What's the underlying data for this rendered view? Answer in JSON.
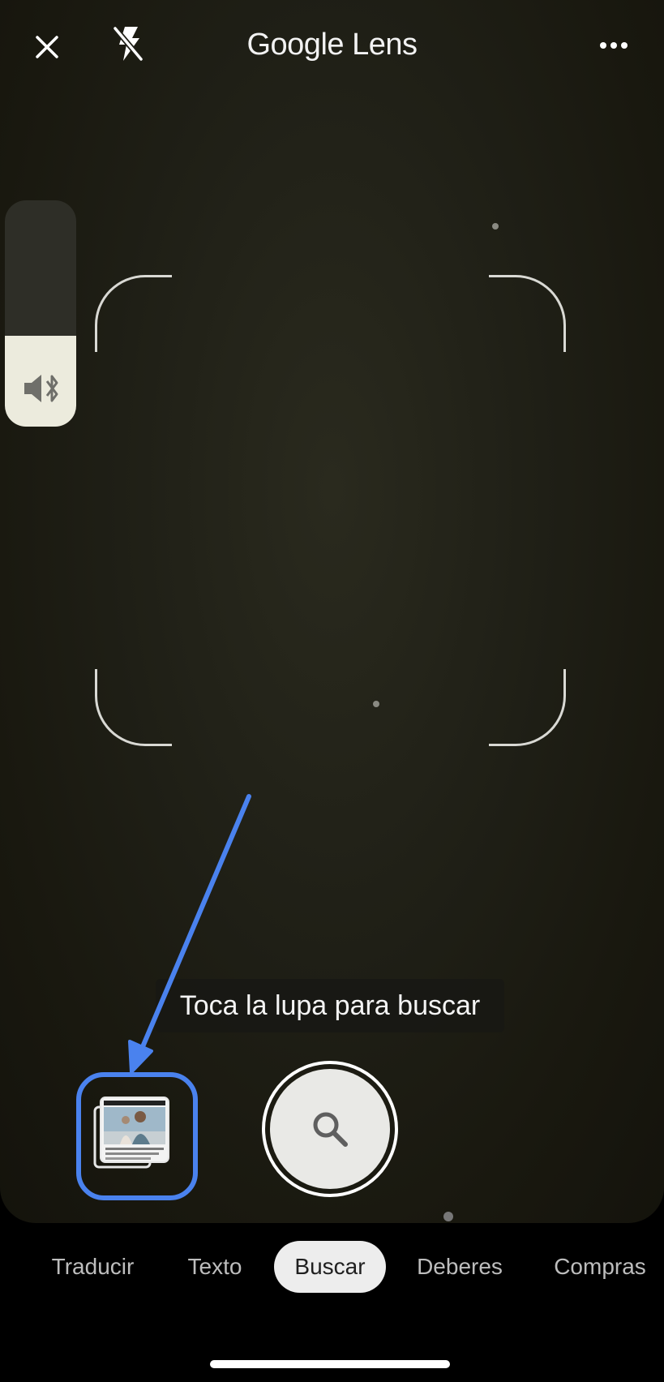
{
  "app": {
    "title_brand": "Google",
    "title_product": "Lens"
  },
  "icons": {
    "close": "close-icon",
    "flash": "flash-off-icon",
    "more": "more-horizontal-icon",
    "volume": "volume-bluetooth-icon",
    "search": "search-icon"
  },
  "volume": {
    "level": 0.4
  },
  "hint": {
    "text": "Toca la lupa para buscar"
  },
  "modes": [
    {
      "label": "Traducir"
    },
    {
      "label": "Texto"
    },
    {
      "label": "Buscar"
    },
    {
      "label": "Deberes"
    },
    {
      "label": "Compras"
    }
  ],
  "selected_mode": "Buscar",
  "colors": {
    "accent_annotation": "#4a82ee",
    "active_chip": "#ededed"
  }
}
